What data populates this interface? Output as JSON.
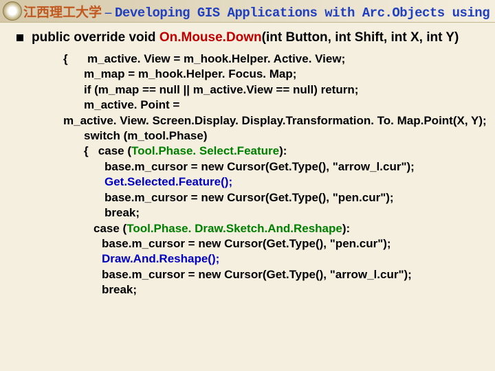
{
  "header": {
    "uni": "江西理工大学",
    "dash": " – ",
    "title": "Developing GIS Applications with Arc.Objects using C#. NE"
  },
  "method": {
    "prefix": "public override void ",
    "name": "On.Mouse.Down",
    "params": "(int Button, int Shift, int X, int Y)"
  },
  "code": {
    "l1a": "{      ",
    "l1b": "m_active. View = m_hook.Helper. Active. View;",
    "l2": "m_map = m_hook.Helper. Focus. Map;",
    "l3": "if (m_map == null || m_active.View == null) return;",
    "l4": "m_active. Point =",
    "l5": "m_active. View. Screen.Display. Display.Transformation. To. Map.Point(X, Y);",
    "l6": "switch (m_tool.Phase)",
    "l7a": "{   case (",
    "l7g": "Tool.Phase. Select.Feature",
    "l7b": "):",
    "l8": "base.m_cursor = new Cursor(Get.Type(), \"arrow_l.cur\");",
    "l9": "Get.Selected.Feature();",
    "l10": "base.m_cursor = new Cursor(Get.Type(), \"pen.cur\");",
    "l11": "break;",
    "l12a": "case (",
    "l12b": "Tool.Phase. Draw.Sketch.And.Reshape",
    "l12c": "):",
    "l13": "base.m_cursor = new Cursor(Get.Type(), \"pen.cur\");",
    "l14": "Draw.And.Reshape();",
    "l15": "base.m_cursor = new Cursor(Get.Type(), \"arrow_l.cur\");",
    "l16": "break;"
  }
}
